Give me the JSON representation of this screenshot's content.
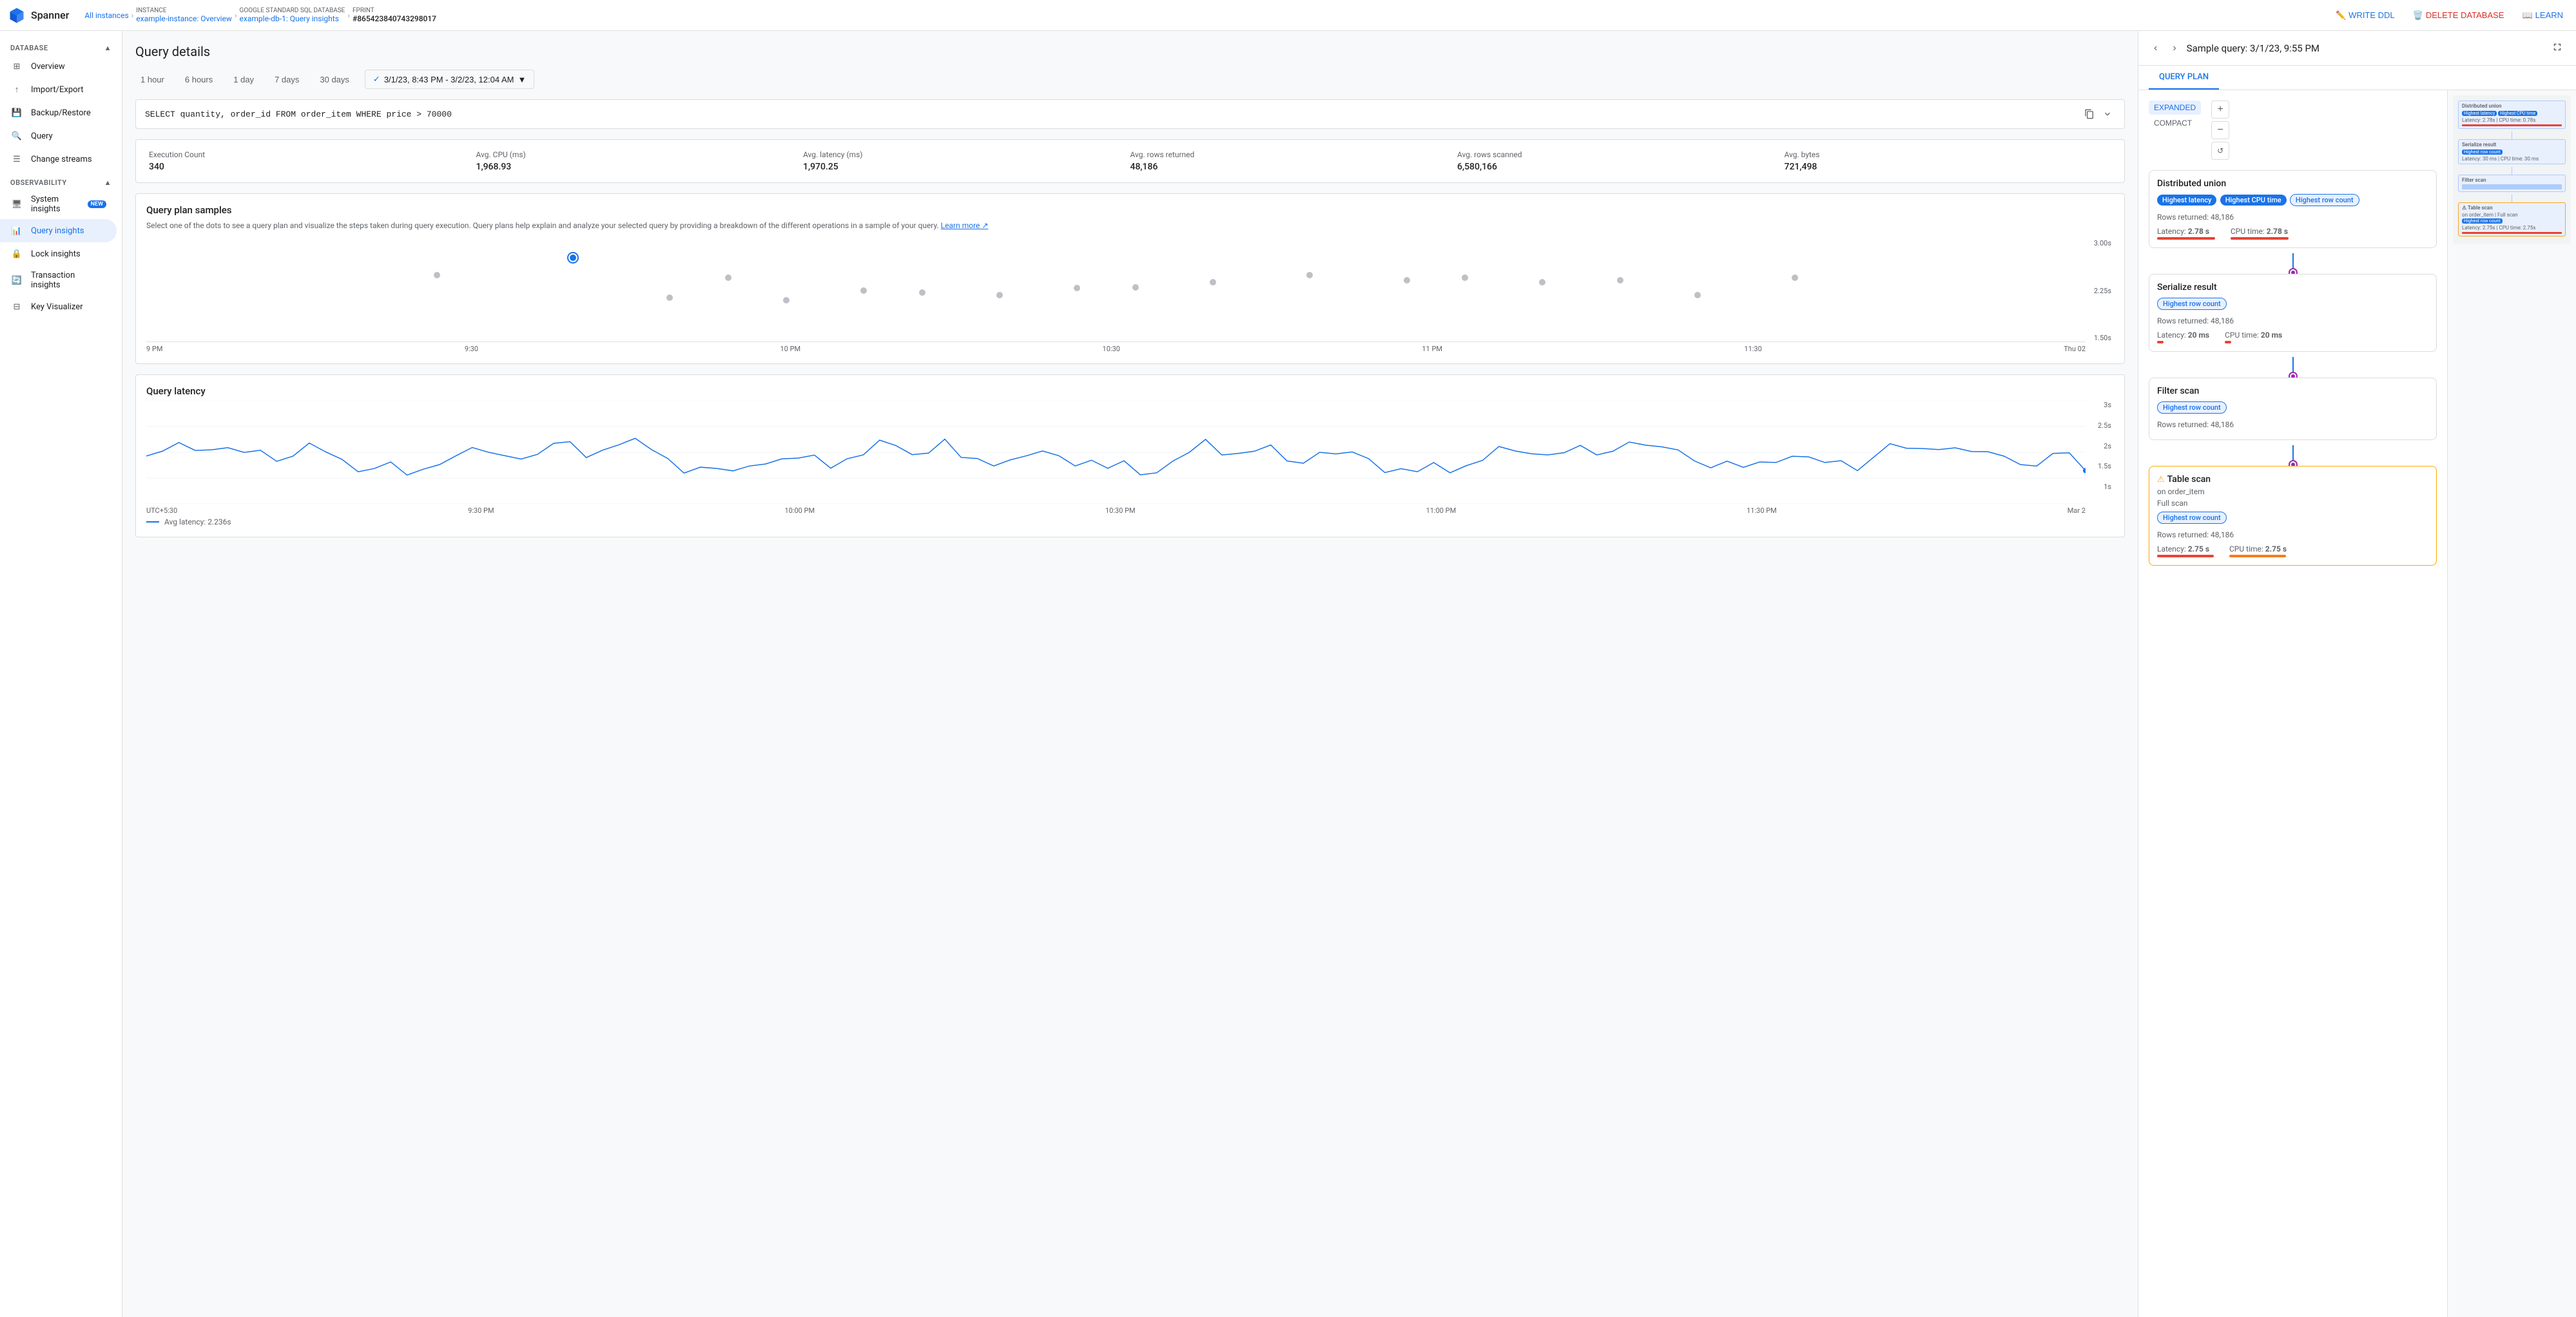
{
  "app": {
    "name": "Spanner"
  },
  "breadcrumb": {
    "items": [
      {
        "label": "All instances",
        "href": "#"
      },
      {
        "label": "INSTANCE",
        "sub": "example-instance: Overview",
        "href": "#"
      },
      {
        "label": "GOOGLE STANDARD SQL DATABASE",
        "sub": "example-db-1: Query insights",
        "href": "#"
      },
      {
        "label": "FPRINT",
        "sub": "#865423840743298017",
        "current": true
      }
    ]
  },
  "nav_actions": {
    "write_ddl": "WRITE DDL",
    "delete_database": "DELETE DATABASE",
    "learn": "LEARN"
  },
  "sidebar": {
    "database_section": "DATABASE",
    "observability_section": "OBSERVABILITY",
    "db_items": [
      {
        "id": "overview",
        "label": "Overview",
        "icon": "grid"
      },
      {
        "id": "import-export",
        "label": "Import/Export",
        "icon": "upload"
      },
      {
        "id": "backup-restore",
        "label": "Backup/Restore",
        "icon": "save"
      },
      {
        "id": "query",
        "label": "Query",
        "icon": "search"
      },
      {
        "id": "change-streams",
        "label": "Change streams",
        "icon": "list"
      }
    ],
    "obs_items": [
      {
        "id": "system-insights",
        "label": "System insights",
        "icon": "monitor",
        "badge": "NEW"
      },
      {
        "id": "query-insights",
        "label": "Query insights",
        "icon": "chart",
        "active": true
      },
      {
        "id": "lock-insights",
        "label": "Lock insights",
        "icon": "lock"
      },
      {
        "id": "transaction-insights",
        "label": "Transaction insights",
        "icon": "refresh"
      },
      {
        "id": "key-visualizer",
        "label": "Key Visualizer",
        "icon": "grid2"
      }
    ]
  },
  "main": {
    "title": "Query details",
    "time_filters": [
      "1 hour",
      "6 hours",
      "1 day",
      "7 days",
      "30 days"
    ],
    "time_range": "3/1/23, 8:43 PM - 3/2/23, 12:04 AM",
    "sql": "SELECT quantity, order_id FROM order_item WHERE price > 70000",
    "stats": [
      {
        "label": "Execution Count",
        "value": "340"
      },
      {
        "label": "Avg. CPU (ms)",
        "value": "1,968.93"
      },
      {
        "label": "Avg. latency (ms)",
        "value": "1,970.25"
      },
      {
        "label": "Avg. rows returned",
        "value": "48,186"
      },
      {
        "label": "Avg. rows scanned",
        "value": "6,580,166"
      },
      {
        "label": "Avg. bytes",
        "value": "721,498"
      }
    ],
    "scatter": {
      "title": "Query plan samples",
      "description": "Select one of the dots to see a query plan and visualize the steps taken during query execution. Query plans help explain and analyze your selected query by providing a breakdown of the different operations in a sample of your query.",
      "learn_more": "Learn more",
      "y_labels": [
        "3.00s",
        "2.25s",
        "1.50s"
      ],
      "x_labels": [
        "9 PM",
        "9:30",
        "10 PM",
        "10:30",
        "11 PM",
        "11:30",
        "Thu 02"
      ],
      "dots": [
        {
          "x": 22,
          "y": 18,
          "selected": true
        },
        {
          "x": 15,
          "y": 35
        },
        {
          "x": 30,
          "y": 38
        },
        {
          "x": 37,
          "y": 50
        },
        {
          "x": 44,
          "y": 55
        },
        {
          "x": 51,
          "y": 47
        },
        {
          "x": 27,
          "y": 57
        },
        {
          "x": 33,
          "y": 60
        },
        {
          "x": 40,
          "y": 52
        },
        {
          "x": 48,
          "y": 48
        },
        {
          "x": 55,
          "y": 42
        },
        {
          "x": 60,
          "y": 35
        },
        {
          "x": 65,
          "y": 40
        },
        {
          "x": 68,
          "y": 38
        },
        {
          "x": 72,
          "y": 42
        },
        {
          "x": 76,
          "y": 40
        },
        {
          "x": 80,
          "y": 55
        },
        {
          "x": 85,
          "y": 38
        }
      ]
    },
    "latency": {
      "title": "Query latency",
      "x_labels": [
        "UTC+5:30",
        "9:30 PM",
        "10:00 PM",
        "10:30 PM",
        "11:00 PM",
        "11:30 PM",
        "Mar 2"
      ],
      "y_labels": [
        "3s",
        "2.5s",
        "2s",
        "1.5s",
        "1s"
      ],
      "legend_label": "Avg latency: 2.236s"
    }
  },
  "right_panel": {
    "title": "Sample query: 3/1/23, 9:55 PM",
    "tabs": [
      "QUERY PLAN"
    ],
    "view_modes": [
      "EXPANDED",
      "COMPACT"
    ],
    "nodes": [
      {
        "id": "distributed-union",
        "title": "Distributed union",
        "badges": [
          {
            "label": "Highest latency",
            "style": "blue"
          },
          {
            "label": "Highest CPU time",
            "style": "blue"
          },
          {
            "label": "Highest row count",
            "style": "blue-outline"
          }
        ],
        "rows_returned": "48,186",
        "latency": "2.78 s",
        "cpu_time": "2.78 s",
        "bar_latency_width": 90,
        "bar_cpu_width": 90,
        "bar_latency_color": "red",
        "bar_cpu_color": "red"
      },
      {
        "id": "serialize-result",
        "title": "Serialize result",
        "badges": [
          {
            "label": "Highest row count",
            "style": "blue-outline"
          }
        ],
        "rows_returned": "48,186",
        "latency": "20 ms",
        "cpu_time": "20 ms",
        "bar_latency_width": 10,
        "bar_cpu_width": 10,
        "bar_latency_color": "red",
        "bar_cpu_color": "red"
      },
      {
        "id": "filter-scan",
        "title": "Filter scan",
        "badges": [
          {
            "label": "Highest row count",
            "style": "blue-outline"
          }
        ],
        "rows_returned": "48,186",
        "latency": null,
        "cpu_time": null
      },
      {
        "id": "table-scan",
        "title": "Table scan",
        "sub": "on order_item",
        "sub2": "Full scan",
        "warning": true,
        "badges": [
          {
            "label": "Highest row count",
            "style": "blue-outline"
          }
        ],
        "rows_returned": "48,186",
        "latency": "2.75 s",
        "cpu_time": "2.75 s",
        "bar_latency_width": 88,
        "bar_cpu_width": 88,
        "bar_latency_color": "red",
        "bar_cpu_color": "orange"
      }
    ]
  }
}
